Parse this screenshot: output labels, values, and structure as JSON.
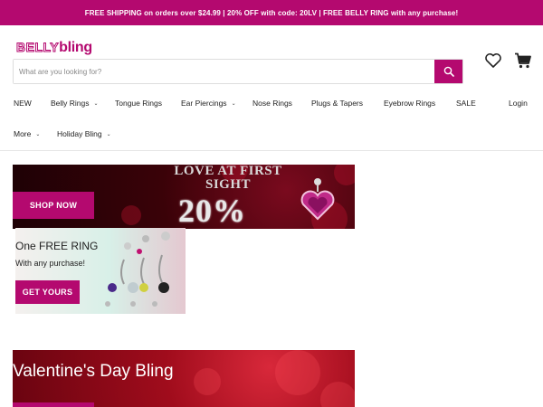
{
  "announcement": "FREE SHIPPING on orders over $24.99 | 20% OFF with code: 20LV | FREE BELLY RING with any purchase!",
  "logo": {
    "part1": "BELLY",
    "part2": "bling"
  },
  "search": {
    "placeholder": "What are you looking for?"
  },
  "icons": {
    "search": "search-icon",
    "wishlist": "heart-icon",
    "cart": "cart-icon"
  },
  "nav": {
    "row1": [
      "NEW",
      "Belly Rings",
      "Tongue Rings",
      "Ear Piercings",
      "Nose Rings",
      "Plugs & Tapers",
      "Eyebrow Rings",
      "SALE"
    ],
    "login": "Login",
    "row2": [
      "More",
      "Holiday Bling"
    ]
  },
  "banner1": {
    "headline": "LOVE AT FIRST SIGHT",
    "percent": "20%",
    "button": "SHOP NOW"
  },
  "banner2": {
    "title": "One FREE RING",
    "subtitle": "With any purchase!",
    "button": "GET YOURS"
  },
  "banner3": {
    "title": "Valentine's Day Bling"
  },
  "colors": {
    "brand": "#b4096f"
  }
}
